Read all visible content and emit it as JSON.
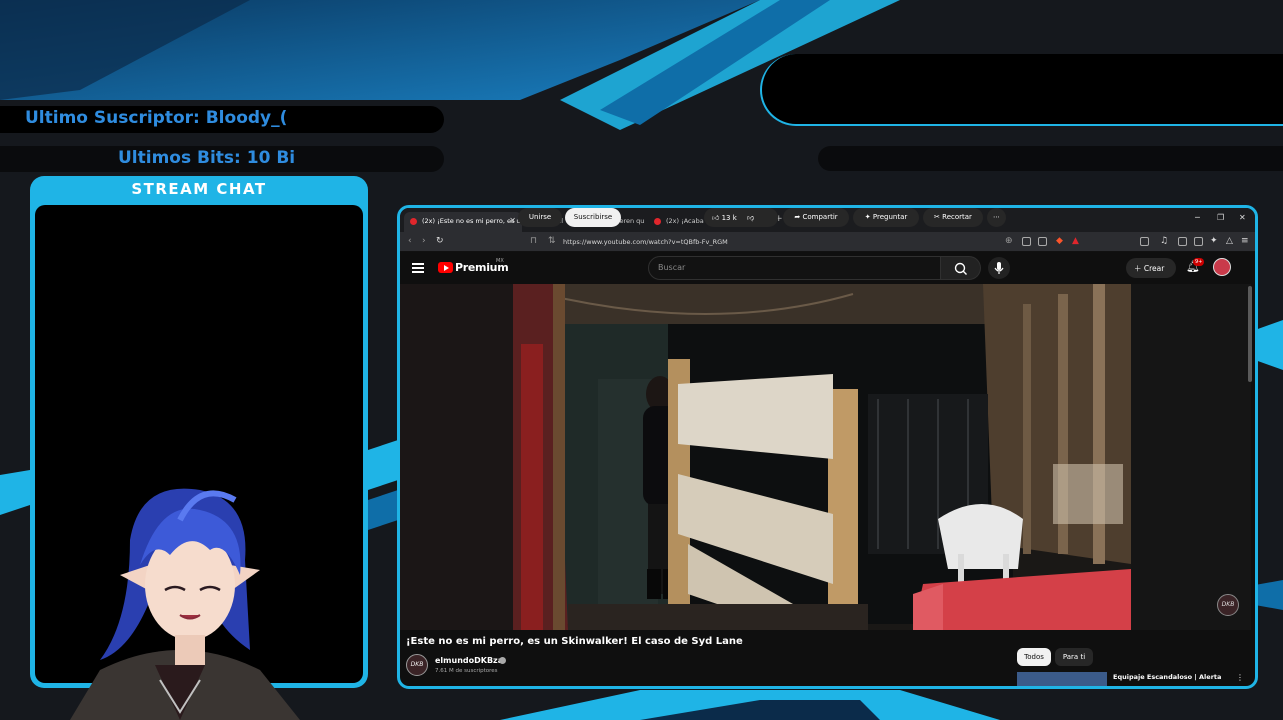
{
  "overlay": {
    "last_subscriber": "Ultimo Suscriptor: Bloody_(",
    "last_bits": "Ultimos Bits: 10 Bi",
    "chat_title": "STREAM CHAT",
    "accent_color": "#1fb4e6"
  },
  "browser": {
    "tabs": [
      {
        "label": "(2x) ¡Este no es mi perro, es un S",
        "active": true
      },
      {
        "label": "(2x) El video que no quieren que vea",
        "active": false
      },
      {
        "label": "(2x) ¡Acaba de pasar esto en un Circ",
        "active": false
      }
    ],
    "new_tab": "+",
    "url": "https://www.youtube.com/watch?v=tQBfb-Fv_RGM"
  },
  "youtube": {
    "brand": "Premium",
    "brand_country": "MX",
    "search_placeholder": "Buscar",
    "create_label": "Crear",
    "notification_badge": "9+",
    "video_title": "¡Este no es mi perro, es un Skinwalker! El caso de Syd Lane",
    "channel_name": "elmundoDKBza",
    "channel_subs": "7.61 M de suscriptores",
    "channel_monogram": "DKB",
    "join_label": "Unirse",
    "subscribe_label": "Suscribirse",
    "likes": "13 k",
    "share_label": "Compartir",
    "ask_label": "Preguntar",
    "clip_label": "Recortar",
    "more_label": "⋯",
    "chip_all": "Todos",
    "chip_for_you": "Para ti",
    "next_video_title": "Equipaje Escandaloso | Alerta"
  }
}
